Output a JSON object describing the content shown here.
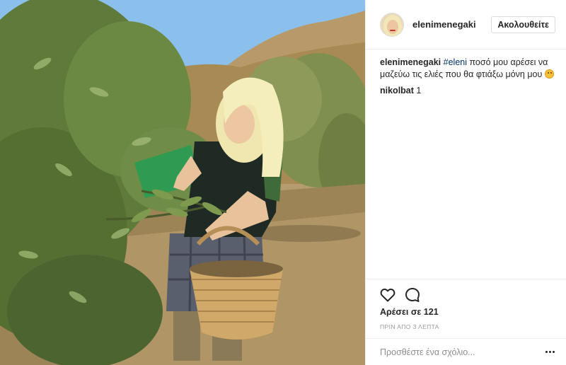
{
  "post": {
    "photo_subject": "woman-picking-olives",
    "username": "elenimenegaki",
    "follow_label": "Ακολουθείτε",
    "caption": {
      "username": "elenimenegaki",
      "hashtag": "#eleni",
      "text": " ποσό μου αρέσει να μαζεύω τις ελιές που θα φτιάξω μόνη μου",
      "emoji": "wink-emoji"
    },
    "comments": [
      {
        "username": "nikolbat",
        "text": "1"
      }
    ],
    "likes_text": "Αρέσει σε 121",
    "timestamp": "ΠΡΙΝ ΑΠΟ 3 ΛΕΠΤΑ",
    "comment_placeholder": "Προσθέστε ένα σχόλιο...",
    "icons": {
      "like": "heart-icon",
      "comment": "speech-bubble-icon",
      "more": "more-options-icon"
    }
  }
}
